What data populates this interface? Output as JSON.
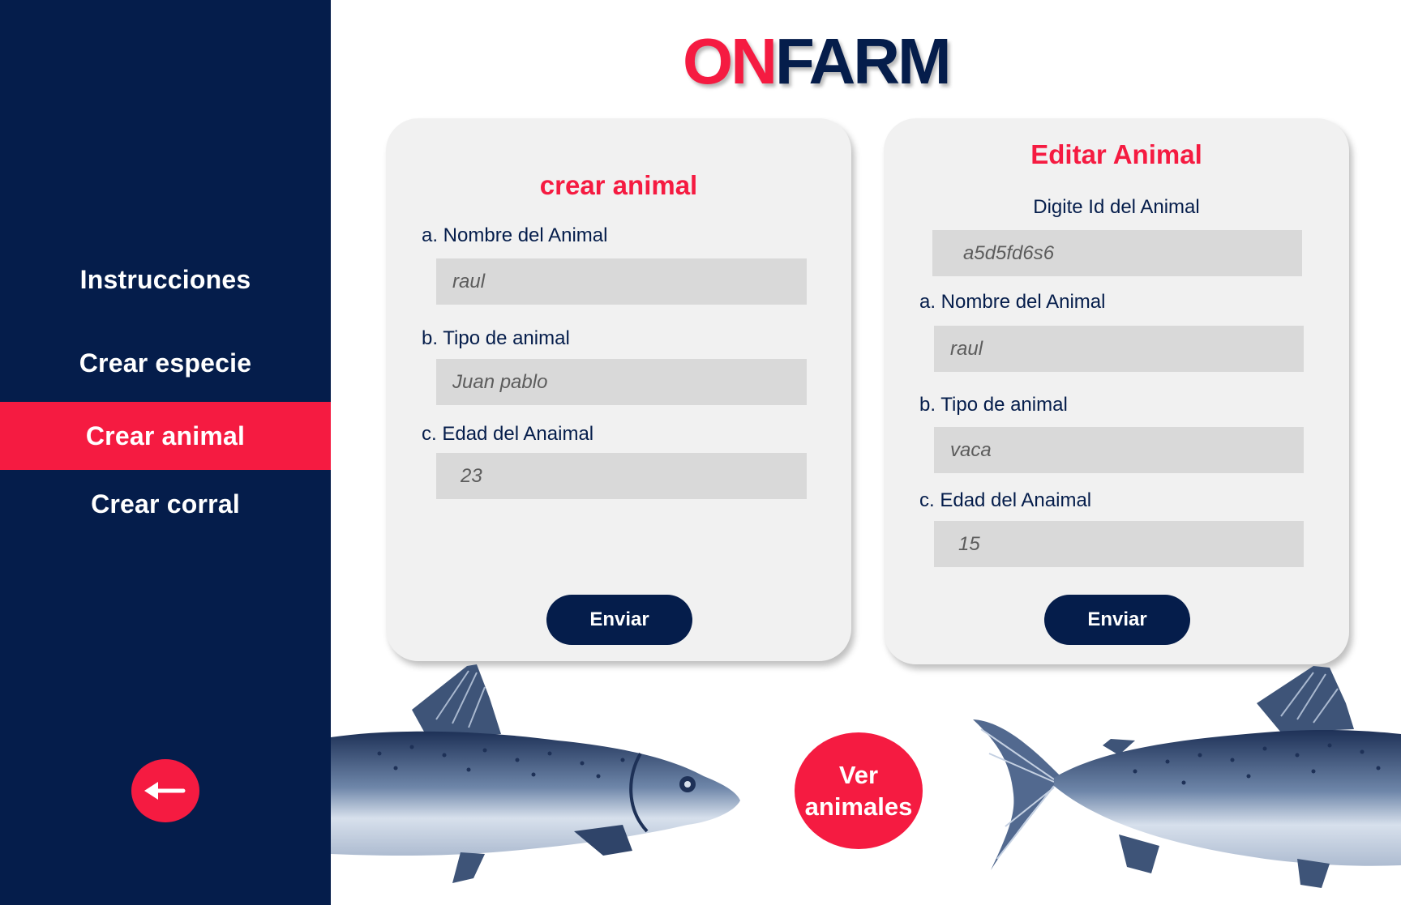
{
  "brand": {
    "on": "ON",
    "farm": "FARM",
    "on_color": "#F51B41",
    "farm_color": "#051D4B"
  },
  "sidebar": {
    "bg_color": "#051D4B",
    "items": [
      {
        "label": "Instrucciones",
        "active": false
      },
      {
        "label": "Crear especie",
        "active": false
      },
      {
        "label": "Crear animal",
        "active": true
      },
      {
        "label": "Crear corral",
        "active": false
      }
    ],
    "back_icon": "arrow-left-icon"
  },
  "create_form": {
    "title": "crear animal",
    "name_label": "a. Nombre  del Animal",
    "name_value": "raul",
    "type_label": "b. Tipo de animal",
    "type_value": "Juan pablo",
    "age_label": "c. Edad del Anaimal",
    "age_value": "23",
    "submit_label": "Enviar"
  },
  "edit_form": {
    "title": "Editar Animal",
    "id_label": "Digite Id del Animal",
    "id_value": "a5d5fd6s6",
    "name_label": "a. Nombre  del Animal",
    "name_value": "raul",
    "type_label": "b. Tipo de animal",
    "type_value": "vaca",
    "age_label": "c. Edad del Anaimal",
    "age_value": "15",
    "submit_label": "Enviar"
  },
  "view_button": {
    "line1": "Ver",
    "line2": "animales"
  },
  "colors": {
    "accent": "#F51B41",
    "navy": "#051D4B",
    "card": "#F1F1F1",
    "input": "#D9D9D9"
  }
}
